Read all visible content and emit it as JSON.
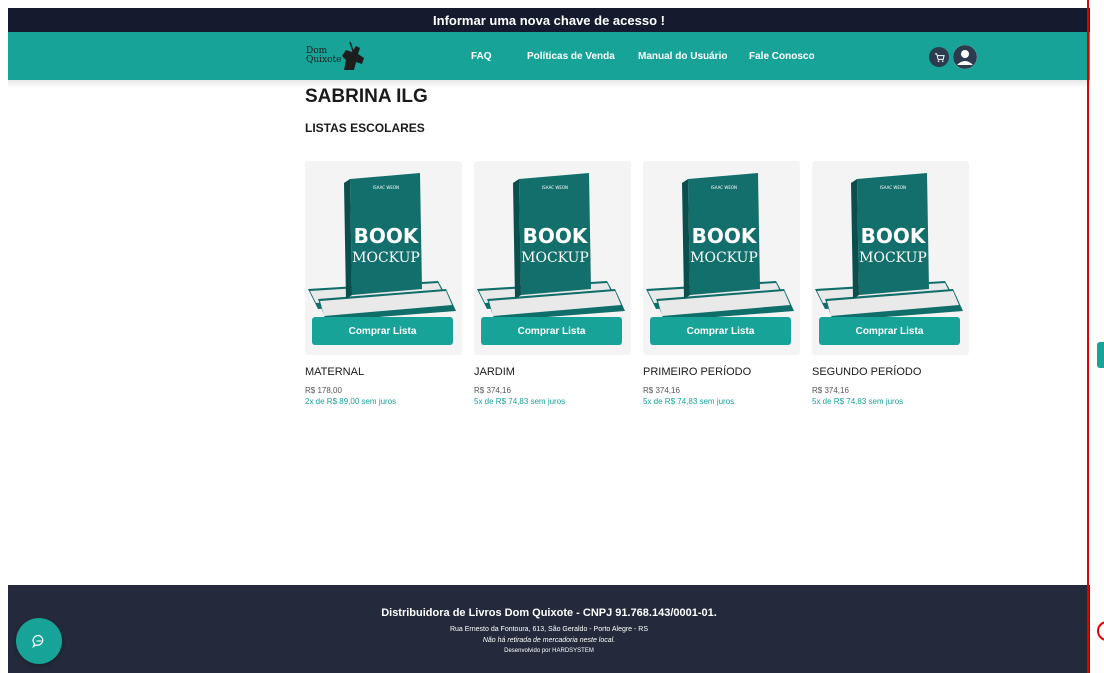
{
  "announcement": "Informar uma nova chave de acesso !",
  "logo": {
    "text_line1": "Dom",
    "text_line2": "Quixote",
    "icon": "knight-horse-icon"
  },
  "nav": {
    "links": [
      "FAQ",
      "Políticas de Venda",
      "Manual do Usuário",
      "Fale Conosco"
    ],
    "cart_icon": "cart-icon",
    "user_icon": "user-icon"
  },
  "page": {
    "title": "SABRINA ILG",
    "section": "LISTAS ESCOLARES"
  },
  "cover": {
    "author": "ISAAC WEON",
    "word1": "BOOK",
    "word2": "MOCKUP"
  },
  "products": [
    {
      "name": "MATERNAL",
      "price": "R$ 178,00",
      "installments": "2x de R$ 89,00 sem juros",
      "button": "Comprar Lista"
    },
    {
      "name": "JARDIM",
      "price": "R$ 374,16",
      "installments": "5x de R$ 74,83 sem juros",
      "button": "Comprar Lista"
    },
    {
      "name": "PRIMEIRO PERÍODO",
      "price": "R$ 374,16",
      "installments": "5x de R$ 74,83 sem juros",
      "button": "Comprar Lista"
    },
    {
      "name": "SEGUNDO PERÍODO",
      "price": "R$ 374,16",
      "installments": "5x de R$ 74,83 sem juros",
      "button": "Comprar Lista"
    }
  ],
  "footer": {
    "company": "Distribuidora de Livros Dom Quixote - CNPJ 91.768.143/0001-01.",
    "address": "Rua Ernesto da Fontoura, 613, São Geraldo - Porto Alegre - RS",
    "notice": "Não há retirada de mercadoria neste local.",
    "credits": "Desenvolvido por HARDSYSTEM"
  },
  "chat": {
    "icon": "chat-bubble-icon"
  },
  "colors": {
    "accent": "#17a398",
    "topbar": "#151a2e",
    "footer": "#242a3b"
  }
}
